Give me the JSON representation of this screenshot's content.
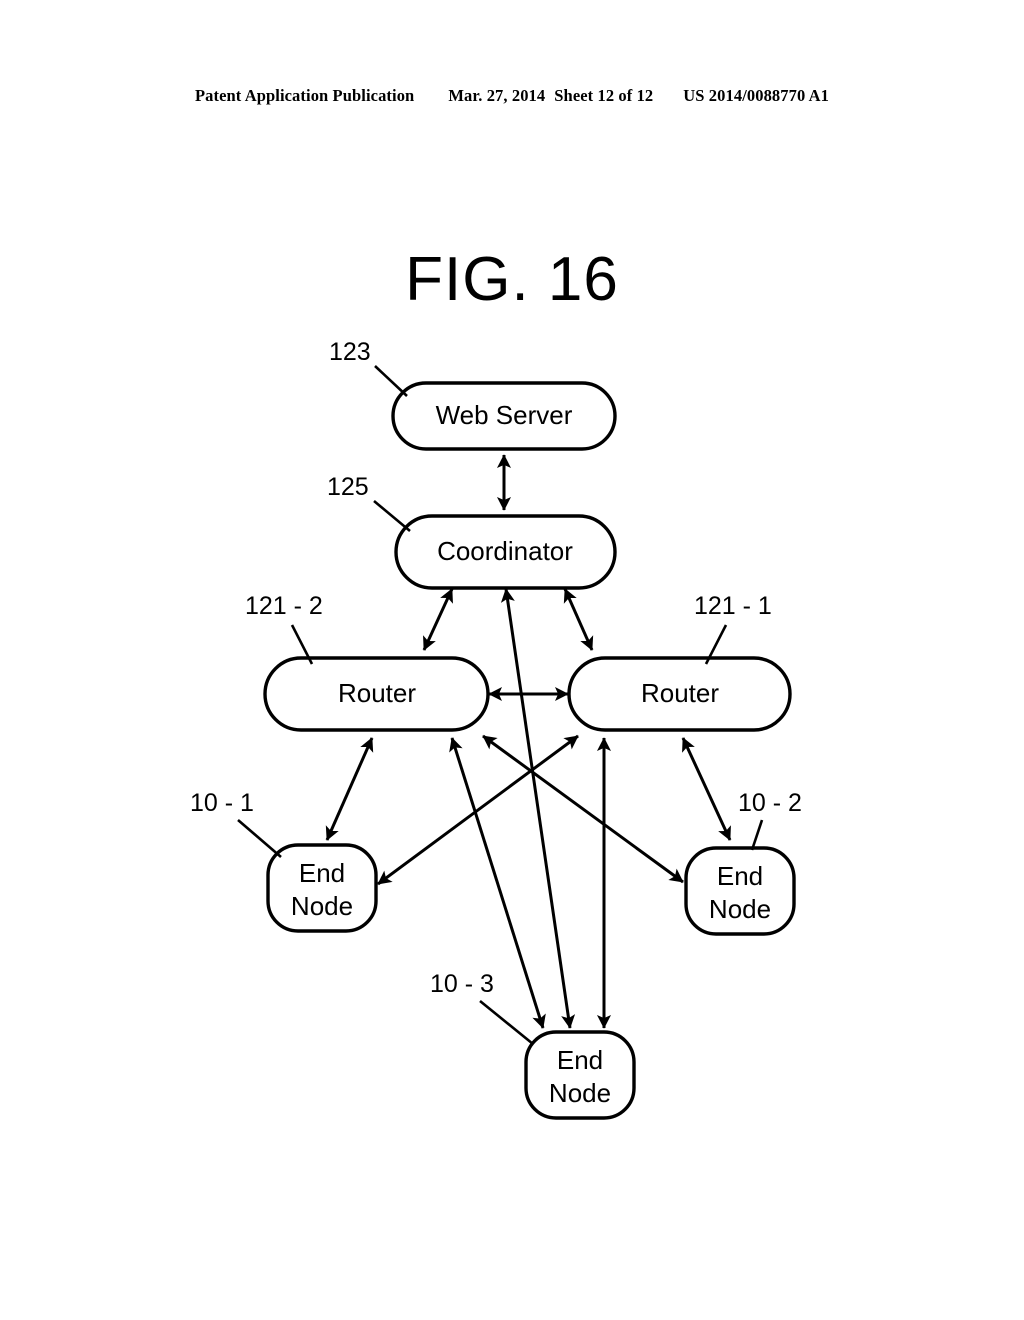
{
  "header": {
    "publication": "Patent Application Publication",
    "date": "Mar. 27, 2014",
    "sheet": "Sheet 12 of 12",
    "patent_number": "US 2014/0088770 A1"
  },
  "figure": {
    "title": "FIG. 16",
    "nodes": [
      {
        "id": "web_server",
        "label": "Web Server",
        "ref": "123",
        "lines": [
          "Web Server"
        ]
      },
      {
        "id": "coordinator",
        "label": "Coordinator",
        "ref": "125",
        "lines": [
          "Coordinator"
        ]
      },
      {
        "id": "router_left",
        "label": "Router",
        "ref": "121 - 2",
        "lines": [
          "Router"
        ]
      },
      {
        "id": "router_right",
        "label": "Router",
        "ref": "121 - 1",
        "lines": [
          "Router"
        ]
      },
      {
        "id": "end_node_1",
        "label": "End Node",
        "ref": "10 - 1",
        "lines": [
          "End",
          "Node"
        ]
      },
      {
        "id": "end_node_2",
        "label": "End Node",
        "ref": "10 - 2",
        "lines": [
          "End",
          "Node"
        ]
      },
      {
        "id": "end_node_3",
        "label": "End Node",
        "ref": "10 - 3",
        "lines": [
          "End",
          "Node"
        ]
      }
    ],
    "links": [
      {
        "from": "web_server",
        "to": "coordinator",
        "arrows": "both"
      },
      {
        "from": "coordinator",
        "to": "router_left",
        "arrows": "both"
      },
      {
        "from": "coordinator",
        "to": "router_right",
        "arrows": "both"
      },
      {
        "from": "coordinator",
        "to": "end_node_3",
        "arrows": "both"
      },
      {
        "from": "router_left",
        "to": "router_right",
        "arrows": "both"
      },
      {
        "from": "router_left",
        "to": "end_node_1",
        "arrows": "both"
      },
      {
        "from": "router_left",
        "to": "end_node_2",
        "arrows": "both"
      },
      {
        "from": "router_left",
        "to": "end_node_3",
        "arrows": "both"
      },
      {
        "from": "router_right",
        "to": "end_node_1",
        "arrows": "both"
      },
      {
        "from": "router_right",
        "to": "end_node_2",
        "arrows": "both"
      },
      {
        "from": "router_right",
        "to": "end_node_3",
        "arrows": "both"
      }
    ],
    "colors": {
      "stroke": "#000000",
      "fill": "#ffffff",
      "background": "#ffffff"
    }
  }
}
